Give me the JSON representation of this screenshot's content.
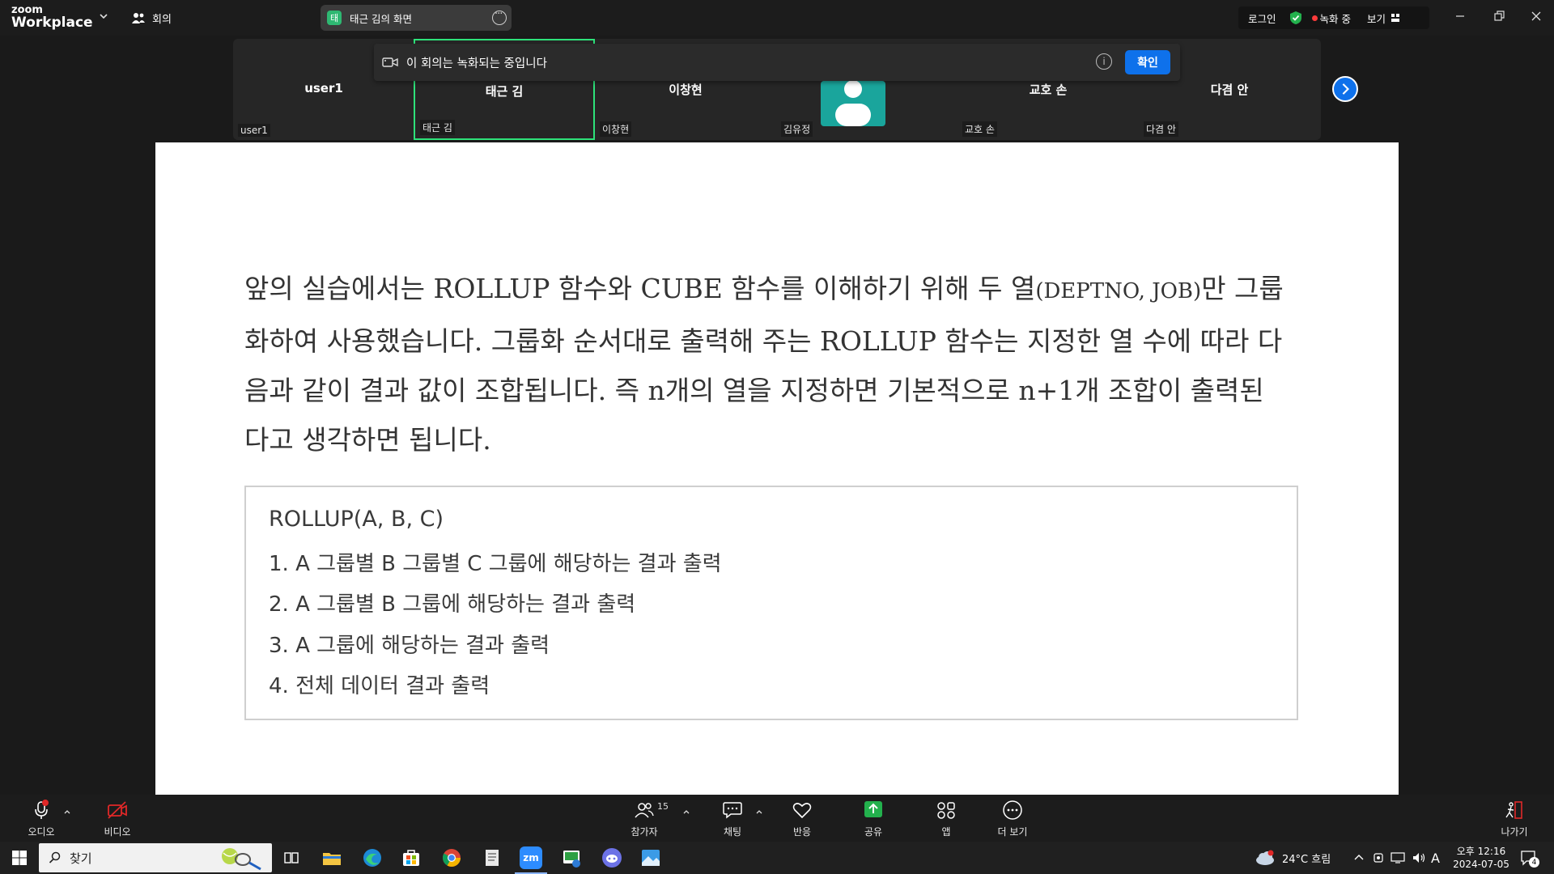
{
  "app": {
    "logo_small": "zoom",
    "logo_big": "Workplace",
    "meeting_label": "회의",
    "share_badge": "태",
    "share_title": "태근 김의 화면"
  },
  "topright": {
    "login": "로그인",
    "recording": "녹화 중",
    "view": "보기"
  },
  "gallery": {
    "tiles": [
      {
        "center": "user1",
        "corner": "user1"
      },
      {
        "center": "태근 김",
        "corner": "태근 김"
      },
      {
        "center": "이창현",
        "corner": "이창현"
      },
      {
        "center": "",
        "corner": "김유정"
      },
      {
        "center": "교호 손",
        "corner": "교호 손"
      },
      {
        "center": "다겸 안",
        "corner": "다겸 안"
      }
    ]
  },
  "notice": {
    "text": "이 회의는 녹화되는 중입니다",
    "info": "i",
    "ok": "확인"
  },
  "content": {
    "line1_a": "앞의 실습에서는 ROLLUP 함수와 CUBE 함수를 이해하기 위해 두 열",
    "line1_sm": "(DEPTNO, JOB)",
    "line1_b": "만 그룹",
    "line2": "화하여 사용했습니다. 그룹화 순서대로 출력해 주는 ROLLUP 함수는 지정한 열 수에 따라 다",
    "line3": "음과 같이 결과 값이 조합됩니다. 즉 n개의 열을 지정하면 기본적으로 n+1개 조합이 출력된",
    "line4": "다고 생각하면 됩니다.",
    "box_title": "ROLLUP(A, B, C)",
    "box_items": [
      "1. A 그룹별 B 그룹별 C 그룹에 해당하는 결과 출력",
      "2. A 그룹별 B 그룹에 해당하는 결과 출력",
      "3. A 그룹에 해당하는 결과 출력",
      "4. 전체 데이터 결과 출력"
    ]
  },
  "toolbar": {
    "audio": "오디오",
    "video": "비디오",
    "participants": "참가자",
    "participants_count": "15",
    "chat": "채팅",
    "reactions": "반응",
    "share": "공유",
    "apps": "앱",
    "more": "더 보기",
    "leave": "나가기"
  },
  "taskbar": {
    "search": "찾기",
    "zoom_label": "zm",
    "weather": "24°C 흐림",
    "ime": "A",
    "time": "오후 12:16",
    "date": "2024-07-05",
    "notif_count": "4",
    "audio_badge": "1"
  },
  "colors": {
    "accent": "#0e71eb",
    "active_border": "#2ee27a",
    "record": "#ff3b3b",
    "share_green": "#2eb872"
  }
}
